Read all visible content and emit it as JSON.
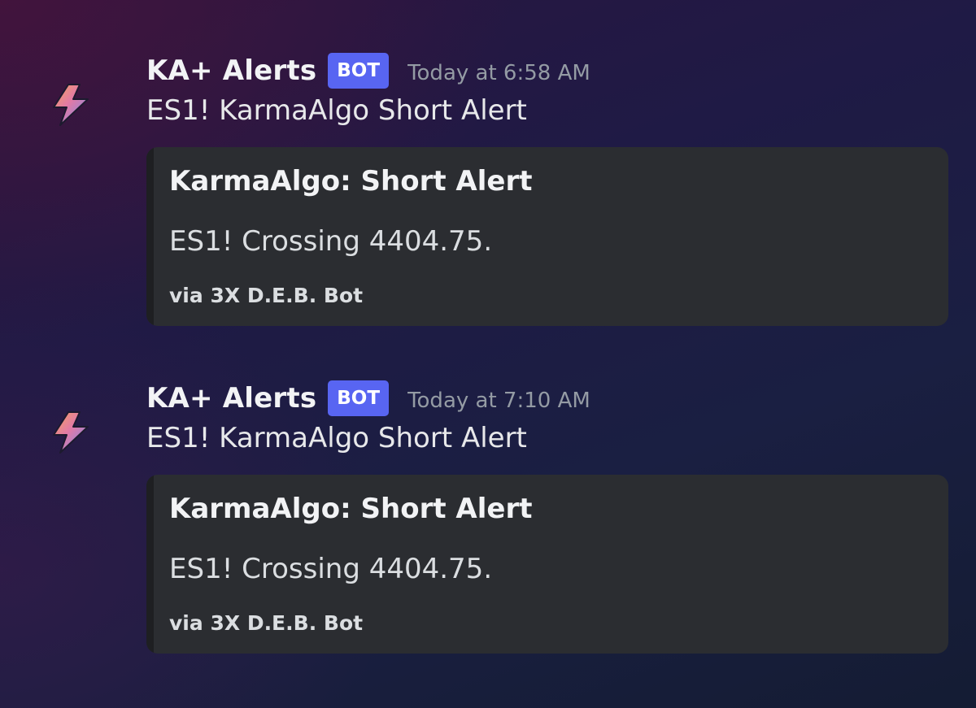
{
  "colors": {
    "bot_badge": "#5865f2",
    "embed_background": "#2b2d31",
    "timestamp": "#949ba4"
  },
  "messages": [
    {
      "avatar_icon": "lightning-bolt-icon",
      "username": "KA+ Alerts",
      "badge": "BOT",
      "timestamp": "Today at 6:58 AM",
      "content": "ES1! KarmaAlgo Short Alert",
      "embed": {
        "title": "KarmaAlgo: Short Alert",
        "description": "ES1! Crossing 4404.75.",
        "footer": "via 3X D.E.B. Bot"
      }
    },
    {
      "avatar_icon": "lightning-bolt-icon",
      "username": "KA+ Alerts",
      "badge": "BOT",
      "timestamp": "Today at 7:10 AM",
      "content": "ES1! KarmaAlgo Short Alert",
      "embed": {
        "title": "KarmaAlgo: Short Alert",
        "description": "ES1! Crossing 4404.75.",
        "footer": "via 3X D.E.B. Bot"
      }
    }
  ]
}
